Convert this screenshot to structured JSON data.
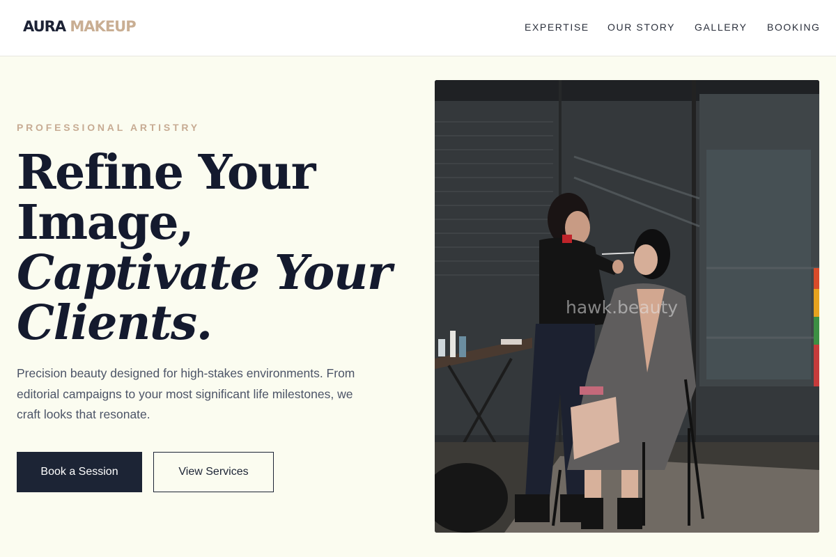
{
  "brand": {
    "name_part1": "AURA",
    "name_part2": "MAKEUP",
    "accent_color": "#c9ae93",
    "dark_color": "#1c2235"
  },
  "nav": {
    "items": [
      {
        "label": "EXPERTISE"
      },
      {
        "label": "OUR STORY"
      },
      {
        "label": "GALLERY"
      },
      {
        "label": "BOOKING"
      }
    ]
  },
  "hero": {
    "eyebrow": "PROFESSIONAL ARTISTRY",
    "headline": {
      "line1": "Refine Your",
      "line2": "Image,",
      "line3": "Captivate Your",
      "line4": "Clients."
    },
    "description": "Precision beauty designed for high-stakes environments. From editorial campaigns to your most significant life milestones, we craft looks that resonate.",
    "primary_button": "Book a Session",
    "secondary_button": "View Services",
    "photo_watermark": "hawk.beauty",
    "background_color": "#fbfcf0"
  }
}
